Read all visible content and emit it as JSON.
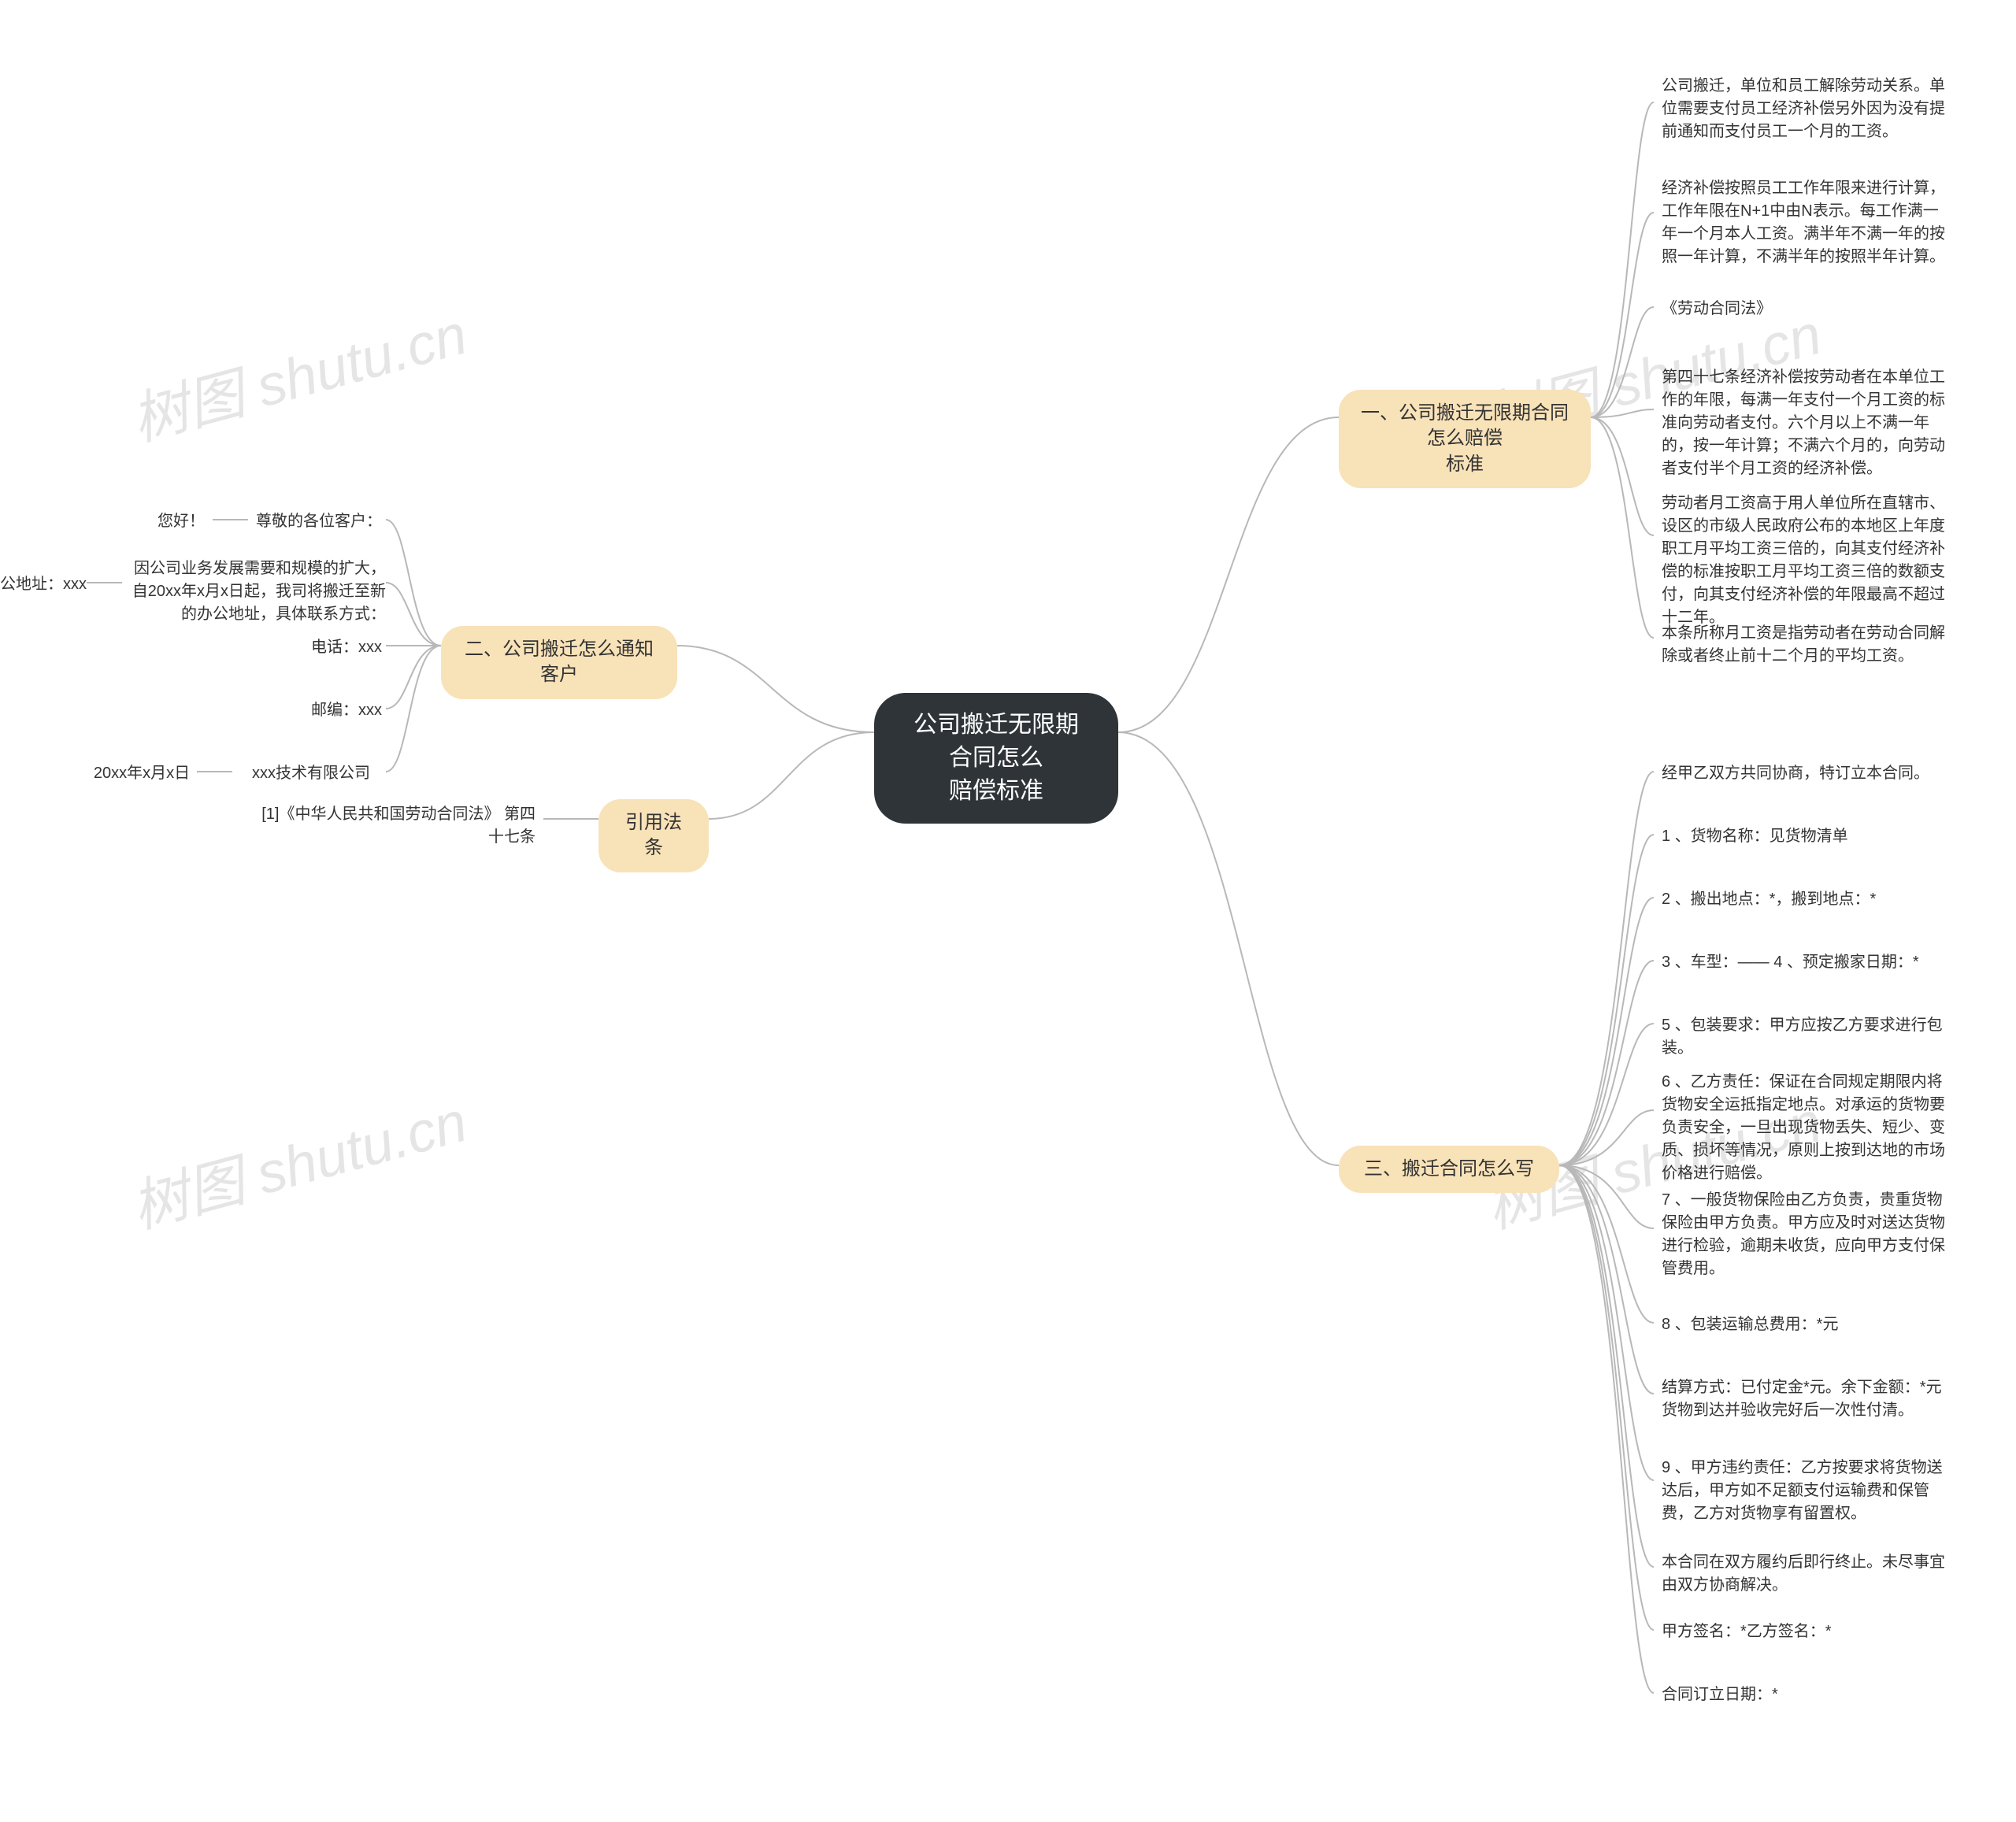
{
  "root": {
    "title": "公司搬迁无限期合同怎么\n赔偿标准"
  },
  "branches": {
    "one": {
      "label": "一、公司搬迁无限期合同怎么赔偿\n标准"
    },
    "two": {
      "label": "二、公司搬迁怎么通知客户"
    },
    "three": {
      "label": "三、搬迁合同怎么写"
    },
    "four": {
      "label": "引用法条"
    }
  },
  "one_leaves": {
    "a": "公司搬迁，单位和员工解除劳动关系。单位需要支付员工经济补偿另外因为没有提前通知而支付员工一个月的工资。",
    "b": "经济补偿按照员工工作年限来进行计算，工作年限在N+1中由N表示。每工作满一年一个月本人工资。满半年不满一年的按照一年计算，不满半年的按照半年计算。",
    "c": "《劳动合同法》",
    "d": "第四十七条经济补偿按劳动者在本单位工作的年限，每满一年支付一个月工资的标准向劳动者支付。六个月以上不满一年的，按一年计算；不满六个月的，向劳动者支付半个月工资的经济补偿。",
    "e": "劳动者月工资高于用人单位所在直辖市、设区的市级人民政府公布的本地区上年度职工月平均工资三倍的，向其支付经济补偿的标准按职工月平均工资三倍的数额支付，向其支付经济补偿的年限最高不超过十二年。",
    "f": "本条所称月工资是指劳动者在劳动合同解除或者终止前十二个月的平均工资。"
  },
  "two_leaves": {
    "a": {
      "left": "您好！",
      "right": "尊敬的各位客户："
    },
    "b": {
      "left": "新办公地址：xxx",
      "right": "因公司业务发展需要和规模的扩大，自20xx年x月x日起，我司将搬迁至新的办公地址，具体联系方式："
    },
    "c": "电话：xxx",
    "d": "邮编：xxx",
    "e": {
      "left": "20xx年x月x日",
      "right": "xxx技术有限公司"
    }
  },
  "three_leaves": {
    "a": "经甲乙双方共同协商，特订立本合同。",
    "b": "1 、货物名称：见货物清单",
    "c": "2 、搬出地点：*，搬到地点：*",
    "d": "3 、车型：—— 4 、预定搬家日期：*",
    "e": "5 、包装要求：甲方应按乙方要求进行包装。",
    "f": "6 、乙方责任：保证在合同规定期限内将货物安全运抵指定地点。对承运的货物要负责安全，一旦出现货物丢失、短少、变质、损坏等情况，原则上按到达地的市场价格进行赔偿。",
    "g": "7 、一般货物保险由乙方负责，贵重货物保险由甲方负责。甲方应及时对送达货物进行检验，逾期未收货，应向甲方支付保管费用。",
    "h": "8 、包装运输总费用：*元",
    "i": "结算方式：已付定金*元。余下金额：*元货物到达并验收完好后一次性付清。",
    "j": "9 、甲方违约责任：乙方按要求将货物送达后，甲方如不足额支付运输费和保管费，乙方对货物享有留置权。",
    "k": "本合同在双方履约后即行终止。未尽事宜由双方协商解决。",
    "l": "甲方签名：*乙方签名：*",
    "m": "合同订立日期：*"
  },
  "four_leaves": {
    "a": "[1]《中华人民共和国劳动合同法》 第四十七条"
  },
  "watermark": "树图 shutu.cn"
}
